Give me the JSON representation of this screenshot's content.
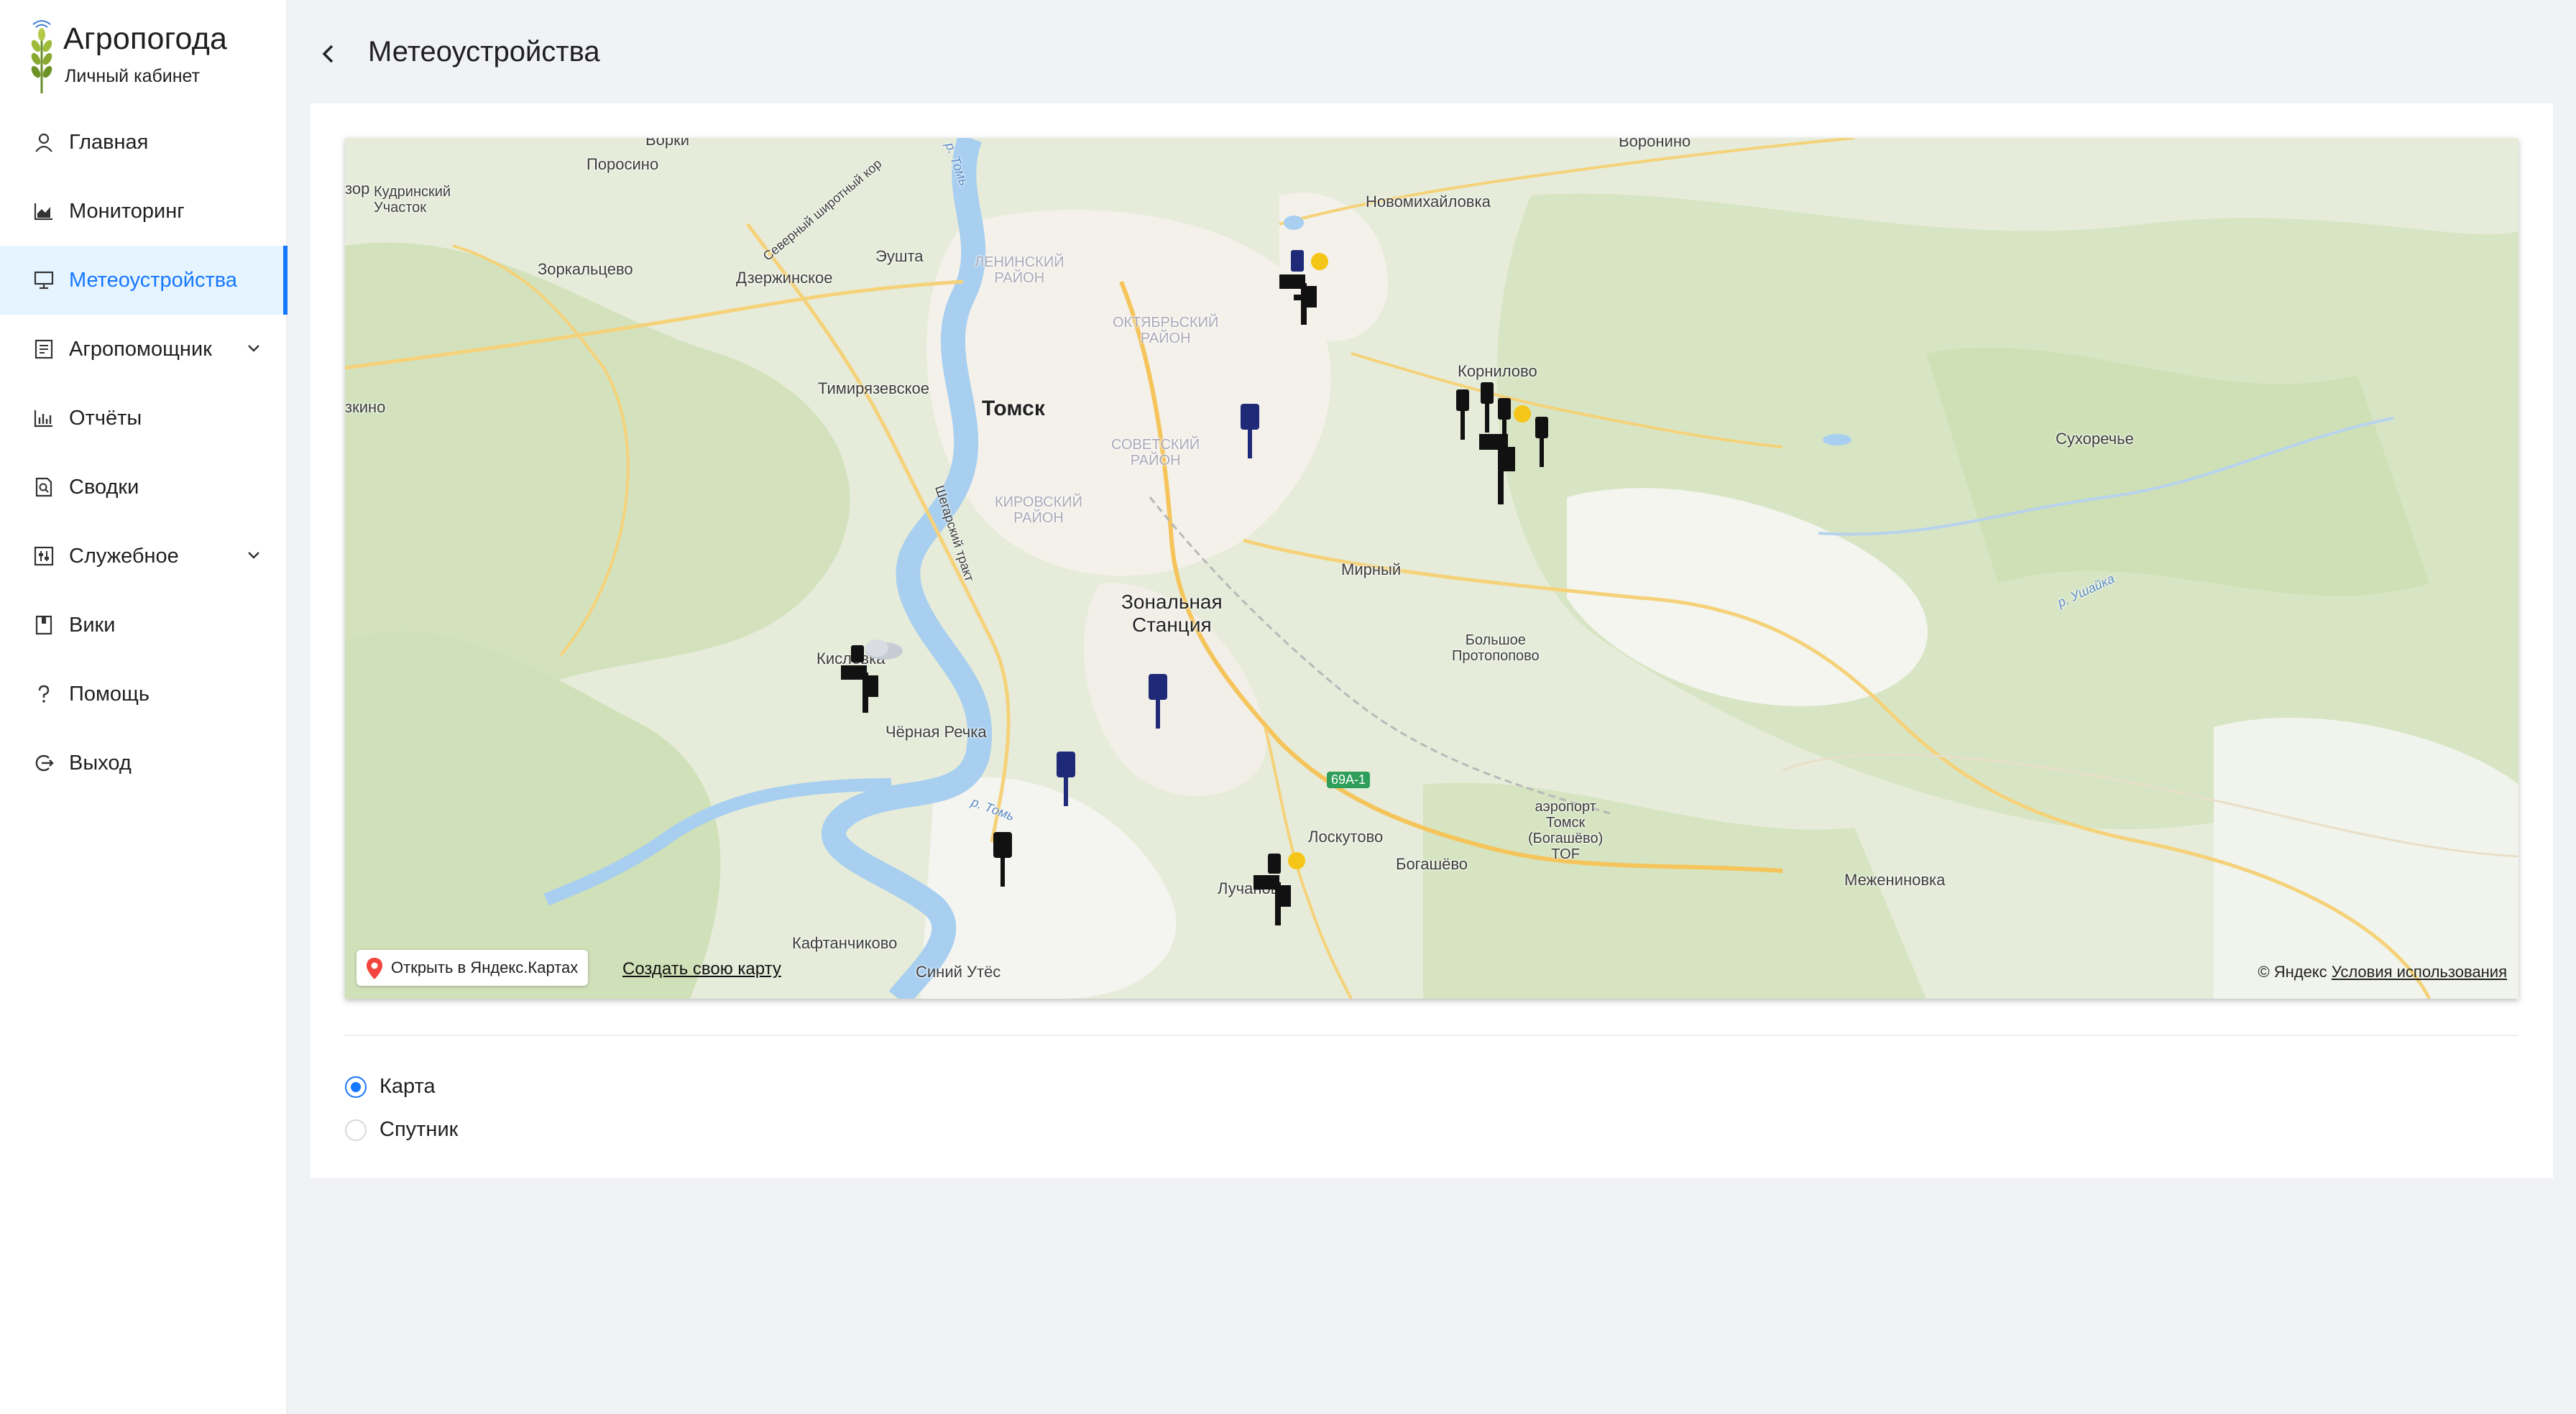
{
  "app": {
    "title": "Агропогода",
    "subtitle": "Личный кабинет"
  },
  "colors": {
    "accent": "#1677ff",
    "active_bg": "#e6f4ff",
    "device_blue": "#1e2a78",
    "sun": "#f5c518"
  },
  "sidebar": {
    "items": [
      {
        "label": "Главная",
        "icon": "user-icon"
      },
      {
        "label": "Мониторинг",
        "icon": "area-chart-icon"
      },
      {
        "label": "Метеоустройства",
        "icon": "desktop-icon",
        "active": true
      },
      {
        "label": "Агропомощник",
        "icon": "profile-icon",
        "expandable": true
      },
      {
        "label": "Отчёты",
        "icon": "bar-chart-icon"
      },
      {
        "label": "Сводки",
        "icon": "file-search-icon"
      },
      {
        "label": "Служебное",
        "icon": "control-icon",
        "expandable": true
      },
      {
        "label": "Вики",
        "icon": "book-icon"
      },
      {
        "label": "Помощь",
        "icon": "question-icon"
      },
      {
        "label": "Выход",
        "icon": "logout-icon"
      }
    ]
  },
  "header": {
    "title": "Метеоустройства"
  },
  "map": {
    "labels": {
      "vorki": "Ворки",
      "porosino": "Поросино",
      "kudrinsky": "Кудринский\nУчасток",
      "zorkaltsevo": "Зоркальцево",
      "dzerzhinskoe": "Дзержинское",
      "eushta": "Эушта",
      "timiryazevskoe": "Тимирязевское",
      "tomsk": "Томск",
      "leninsky": "ЛЕНИНСКИЙ\nРАЙОН",
      "oktyabrsky": "ОКТЯБРЬСКИЙ\nРАЙОН",
      "sovetsky": "СОВЕТСКИЙ\nРАЙОН",
      "kirovsky": "КИРОВСКИЙ\nРАЙОН",
      "zonalnaya": "Зональная\nСтанция",
      "mirny": "Мирный",
      "kislovka": "Кисловка",
      "chernaya_rechka": "Чёрная Речка",
      "voronino": "Воронино",
      "novomikhailovka": "Новомихайловка",
      "kornilovo": "Корнилово",
      "sukhorechye": "Сухоречье",
      "bolshoe": "Большое\nПротопопово",
      "airport": "аэропорт\nТомск\n(Богашёво)\nTOF",
      "loskutovo": "Лоскутово",
      "bogashevo": "Богашёво",
      "luchanovo": "Лучаново",
      "mezheninovka": "Межениновка",
      "kaftanchikovo": "Кафтанчиково",
      "siniy_utes": "Синий Утёс",
      "ezhino": "зкино",
      "zor": "зор",
      "road_69a": "69А-1",
      "river_tom1": "р. Томь",
      "river_tom2": "р. Томь",
      "river_ushayka": "р. Ушайка",
      "severny": "Северный широтный кор",
      "shegarsky": "Шегарский тракт"
    },
    "open_in_yandex": "Открыть в Яндекс.Картах",
    "create_map": "Создать свою карту",
    "copyright": "© Яндекс",
    "terms": "Условия использования",
    "devices": [
      {
        "type": "station",
        "weather": "sun-icon"
      },
      {
        "type": "sensor-blue"
      },
      {
        "type": "station",
        "weather": "sun-icon"
      },
      {
        "type": "station",
        "weather": "cloud-icon"
      },
      {
        "type": "sensor-blue"
      },
      {
        "type": "sensor-blue"
      },
      {
        "type": "sensor-black"
      },
      {
        "type": "station",
        "weather": "sun-icon"
      }
    ]
  },
  "view_switch": {
    "options": [
      {
        "label": "Карта",
        "selected": true
      },
      {
        "label": "Спутник",
        "selected": false
      }
    ]
  }
}
